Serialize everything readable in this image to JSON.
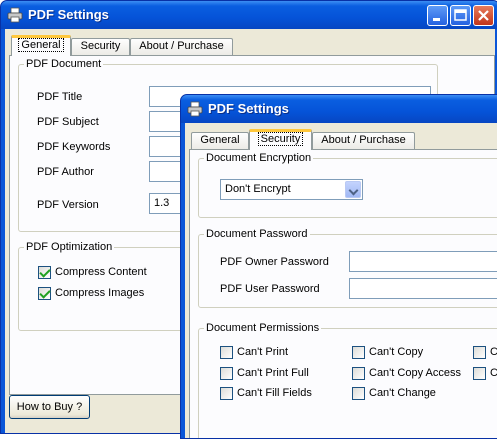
{
  "back_window": {
    "title": "PDF Settings",
    "tabs": [
      {
        "label": "General"
      },
      {
        "label": "Security"
      },
      {
        "label": "About / Purchase"
      }
    ],
    "pdf_document": {
      "legend": "PDF Document",
      "title_label": "PDF Title",
      "title_value": "",
      "subject_label": "PDF Subject",
      "subject_value": "",
      "keywords_label": "PDF Keywords",
      "keywords_value": "",
      "author_label": "PDF Author",
      "author_value": "",
      "version_label": "PDF Version",
      "version_value": "1.3"
    },
    "pdf_optimization": {
      "legend": "PDF Optimization",
      "compress_content_label": "Compress Content",
      "compress_content_checked": true,
      "compress_images_label": "Compress Images",
      "compress_images_checked": true
    },
    "how_to_buy_label": "How to Buy ?"
  },
  "front_window": {
    "title": "PDF Settings",
    "tabs": [
      {
        "label": "General"
      },
      {
        "label": "Security"
      },
      {
        "label": "About / Purchase"
      }
    ],
    "encryption": {
      "legend": "Document Encryption",
      "selected": "Don't Encrypt"
    },
    "password": {
      "legend": "Document Password",
      "owner_label": "PDF Owner Password",
      "owner_value": "",
      "user_label": "PDF User Password",
      "user_value": ""
    },
    "permissions": {
      "legend": "Document Permissions",
      "items": [
        {
          "label": "Can't Print",
          "checked": false
        },
        {
          "label": "Can't Copy",
          "checked": false
        },
        {
          "label": "Ca",
          "checked": false
        },
        {
          "label": "Can't Print Full",
          "checked": false
        },
        {
          "label": "Can't Copy Access",
          "checked": false
        },
        {
          "label": "Ca",
          "checked": false
        },
        {
          "label": "Can't Fill Fields",
          "checked": false
        },
        {
          "label": "Can't Change",
          "checked": false
        }
      ]
    }
  },
  "colors": {
    "titlebar": "#0553d8",
    "dialog_face": "#ece9d8",
    "active_tab_highlight": "#ffc83c",
    "check_mark": "#21a121"
  }
}
